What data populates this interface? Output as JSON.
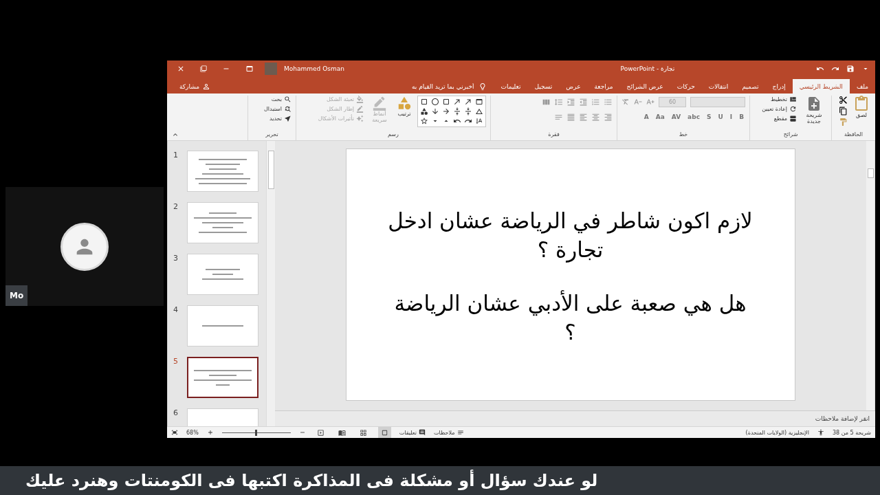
{
  "participant": {
    "name": "Mo"
  },
  "powerpoint": {
    "title_bar": {
      "document": "تجارة - PowerPoint",
      "user": "Mohammed Osman"
    },
    "tabs": [
      {
        "label": "ملف",
        "selected": false
      },
      {
        "label": "الشريط الرئيسي",
        "selected": true
      },
      {
        "label": "إدراج",
        "selected": false
      },
      {
        "label": "تصميم",
        "selected": false
      },
      {
        "label": "انتقالات",
        "selected": false
      },
      {
        "label": "حركات",
        "selected": false
      },
      {
        "label": "عرض الشرائح",
        "selected": false
      },
      {
        "label": "مراجعة",
        "selected": false
      },
      {
        "label": "عرض",
        "selected": false
      },
      {
        "label": "تسجيل",
        "selected": false
      },
      {
        "label": "تعليمات",
        "selected": false
      }
    ],
    "tell_me": {
      "placeholder": "أخبرني بما تريد القيام به"
    },
    "share": "مشاركة",
    "ribbon": {
      "clipboard": {
        "label": "الحافظة",
        "paste": "لصق"
      },
      "slides": {
        "label": "شرائح",
        "new_slide": "شريحة جديدة",
        "items": [
          "تخطيط",
          "إعادة تعيين",
          "مقطع"
        ]
      },
      "font": {
        "label": "خط",
        "size": "60",
        "buttons": [
          "B",
          "I",
          "U",
          "S",
          "abc",
          "AV",
          "Aa",
          "A"
        ]
      },
      "paragraph": {
        "label": "فقرة"
      },
      "drawing": {
        "label": "رسم",
        "arrange": "ترتيب",
        "quick_styles": {
          "label": "أنماط سريعة",
          "disabled": true
        },
        "shape_options": [
          {
            "label": "تعبئة الشكل",
            "disabled": true
          },
          {
            "label": "إطار الشكل",
            "disabled": true
          },
          {
            "label": "تأثيرات الأشكال",
            "disabled": true
          }
        ]
      },
      "editing": {
        "label": "تحرير",
        "items": [
          "بحث",
          "استبدال",
          "تحديد"
        ]
      }
    },
    "thumbnails": [
      {
        "number": "1",
        "selected": false
      },
      {
        "number": "2",
        "selected": false
      },
      {
        "number": "3",
        "selected": false
      },
      {
        "number": "4",
        "selected": false
      },
      {
        "number": "5",
        "selected": true
      },
      {
        "number": "6",
        "selected": false
      }
    ],
    "slide": {
      "paragraphs": [
        "لازم اكون شاطر في الرياضة عشان ادخل تجارة ؟",
        "هل هي صعبة على الأدبي عشان الرياضة ؟"
      ]
    },
    "notes": {
      "placeholder": "انقر لإضافة ملاحظات"
    },
    "status_bar": {
      "slide_counter": "شريحة 5 من 38",
      "language": "الإنجليزية (الولايات المتحدة)",
      "notes": "ملاحظات",
      "comments": "تعليقات",
      "zoom": "68%",
      "zoom_slider": {
        "level": 0.5
      }
    }
  },
  "banner": "لو عندك سؤال أو مشكلة فى المذاكرة اكتبها فى الكومنتات وهنرد عليك"
}
